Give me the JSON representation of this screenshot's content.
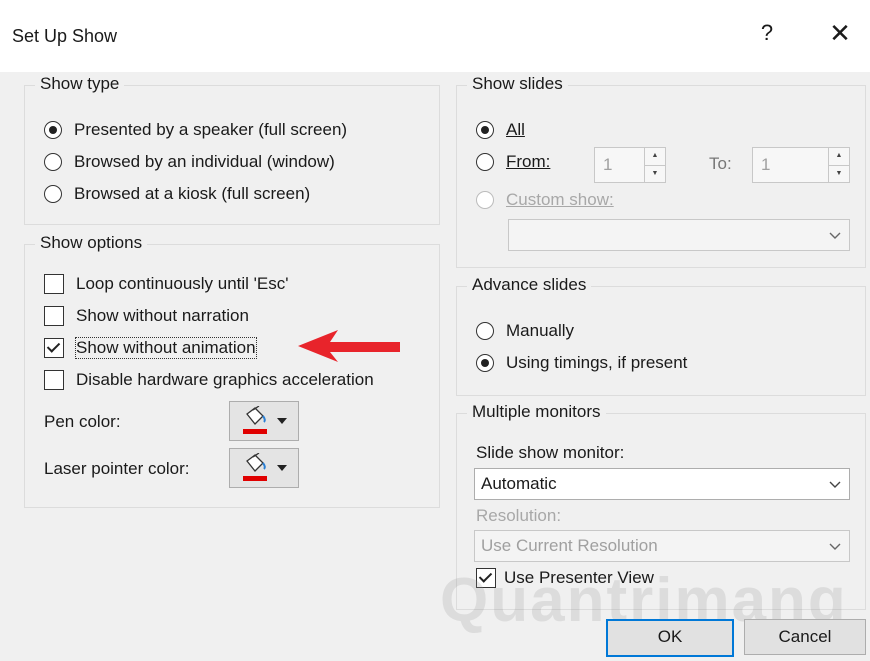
{
  "window": {
    "title": "Set Up Show",
    "help": "?",
    "close": "✕"
  },
  "show_type": {
    "legend": "Show type",
    "options": [
      {
        "label": "Presented by a speaker (full screen)",
        "checked": true
      },
      {
        "label": "Browsed by an individual (window)",
        "checked": false
      },
      {
        "label": "Browsed at a kiosk (full screen)",
        "checked": false
      }
    ]
  },
  "show_options": {
    "legend": "Show options",
    "checks": [
      {
        "label": "Loop continuously until 'Esc'",
        "checked": false
      },
      {
        "label": "Show without narration",
        "checked": false
      },
      {
        "label": "Show without animation",
        "checked": true
      },
      {
        "label": "Disable hardware graphics acceleration",
        "checked": false
      }
    ],
    "pen_color_label": "Pen color:",
    "laser_color_label": "Laser pointer color:",
    "pen_color": "#e00000",
    "laser_color": "#e00000"
  },
  "show_slides": {
    "legend": "Show slides",
    "all_label": "All",
    "from_label": "From:",
    "from_value": "1",
    "to_label": "To:",
    "to_value": "1",
    "custom_label": "Custom show:",
    "custom_value": ""
  },
  "advance_slides": {
    "legend": "Advance slides",
    "manually_label": "Manually",
    "timings_label": "Using timings, if present"
  },
  "multiple_monitors": {
    "legend": "Multiple monitors",
    "monitor_label": "Slide show monitor:",
    "monitor_value": "Automatic",
    "resolution_label": "Resolution:",
    "resolution_value": "Use Current Resolution",
    "presenter_view_label": "Use Presenter View",
    "presenter_view_checked": true
  },
  "buttons": {
    "ok": "OK",
    "cancel": "Cancel"
  },
  "watermark": "Quantrimang",
  "colors": {
    "accent": "#0078d7",
    "arrow": "#e8242b"
  }
}
